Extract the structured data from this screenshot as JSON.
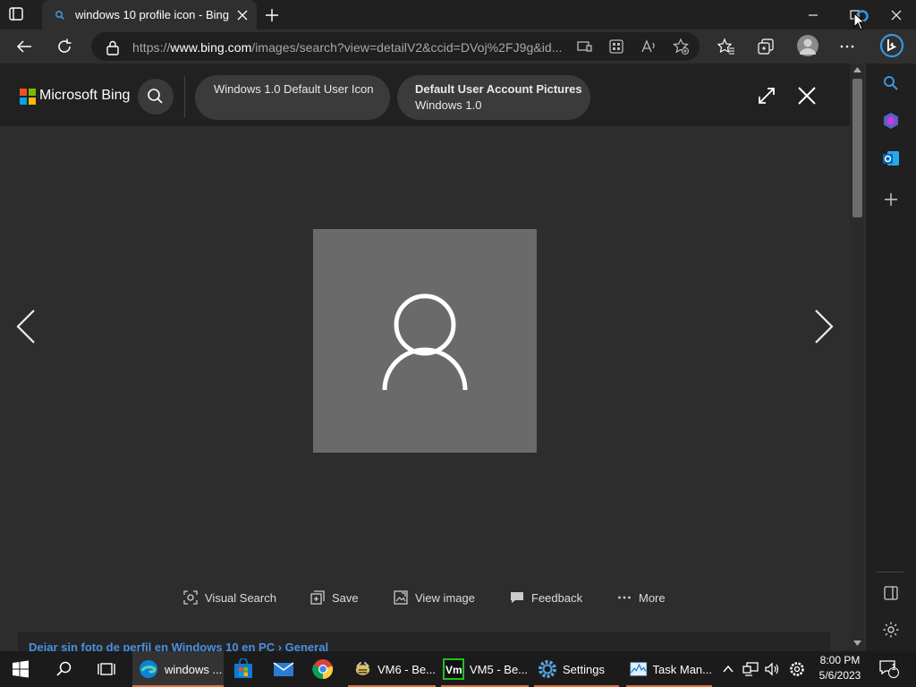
{
  "browser": {
    "tab_title": "windows 10 profile icon - Bing",
    "url_prefix": "https://",
    "url_domain": "www.bing.com",
    "url_rest": "/images/search?view=detailV2&ccid=DVoj%2FJ9g&id..."
  },
  "viewer": {
    "brand": "Microsoft Bing",
    "related": [
      {
        "title": "Windows 1.0 Default User Icon"
      },
      {
        "title": "Default User Account Pictures",
        "subtitle": "Windows 1.0"
      }
    ],
    "actions": {
      "visual_search": "Visual Search",
      "save": "Save",
      "view_image": "View image",
      "feedback": "Feedback",
      "more": "More"
    },
    "result_link": "Dejar sin foto de perfil en Windows 10 en PC › General"
  },
  "taskbar": {
    "items": [
      {
        "label": "windows ..."
      },
      {
        "label": "VM6 - Be..."
      },
      {
        "label": "VM5 - Be..."
      },
      {
        "label": "Settings"
      },
      {
        "label": "Task Man..."
      }
    ],
    "time": "8:00 PM",
    "date": "5/6/2023",
    "notification_count": "1"
  },
  "colors": {
    "accent": "#e0703a",
    "link": "#4a90e2",
    "bing_blue": "#1f8ee0"
  }
}
